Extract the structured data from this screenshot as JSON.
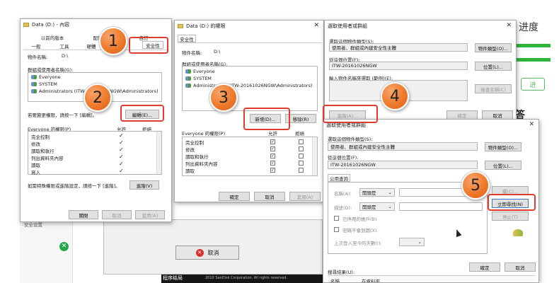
{
  "bg": {
    "title_char": "进度",
    "cursor_hint": "进",
    "question_char": "答",
    "bottom_label": "程序结局",
    "copyright": "2010 SanDisk Corporation. All rights reserved.",
    "cancel_label": "取消",
    "left_text": "安全设置"
  },
  "w1": {
    "title": "Data (D:) - 內容",
    "tabs_top": [
      "以前的版本",
      "配額",
      "自訂"
    ],
    "tabs_bottom": [
      "一般",
      "工具",
      "硬體",
      "共用",
      "安全性"
    ],
    "object_label": "物件名稱:",
    "object_value": "D:\\",
    "group_label": "群組或使用者名稱(G):",
    "users": [
      "Everyone",
      "SYSTEM",
      "Administrators (ITW-20161026NGW\\Administrators)"
    ],
    "change_hint": "若要變更權限，請按一下 [編輯]。",
    "edit_button": "編輯(E)...",
    "perm_label": "Everyone 的權限(P)",
    "allow": "允許",
    "deny": "拒絕",
    "perms": [
      "完全控制",
      "修改",
      "讀取和執行",
      "列出資料夾內容",
      "讀取",
      "寫入"
    ],
    "advanced_hint": "如需特殊權限或進階設定，請按一下 [進階]。",
    "advanced_button": "進階(V)",
    "ok": "關閉",
    "cancel": "取消",
    "apply": "套用(A)"
  },
  "w2": {
    "title": "Data (D:) 的權限",
    "tab": "安全性",
    "object_label": "物件名稱:",
    "object_value": "D:\\",
    "group_label": "群組或使用者名稱(G):",
    "users": [
      "Everyone",
      "SYSTEM",
      "Administrators (ITW-20161026NGW\\Administrators)"
    ],
    "add_button": "新增(D)...",
    "remove_button": "移除(R)",
    "perm_label": "Everyone 的權限(P)",
    "allow": "允許",
    "deny": "拒絕",
    "perms": [
      "完全控制",
      "修改",
      "讀取和執行",
      "列出資料夾內容",
      "讀取"
    ],
    "ok": "確定",
    "cancel": "取消",
    "apply": "套用(A)"
  },
  "w3": {
    "title": "選取使用者或群組",
    "type_label": "選取這個物件類型(S):",
    "type_value": "使用者、群組或內建安全性主體",
    "type_button": "物件類型(O)...",
    "loc_label": "從這個位置(F):",
    "loc_value": "ITW-20161026NGW",
    "loc_button": "位置(L)...",
    "name_label": "輸入物件名稱來選取 (範例)(E):",
    "check_button": "檢查名稱(C)",
    "advanced_button": "進階(A)...",
    "ok": "確定",
    "cancel": "取消"
  },
  "w4": {
    "title": "選取使用者或群組",
    "type_label": "選取這個物件類型(S):",
    "type_value": "使用者、群組或內建安全性主體",
    "type_button": "物件類型(O)...",
    "loc_label": "從這個位置(F):",
    "loc_value": "ITW-20161026NGW",
    "loc_button": "位置(L)...",
    "tab": "公用查詢",
    "name_label": "名稱(A):",
    "desc_label": "描述(D):",
    "starts_with": "開頭是",
    "disabled_label": "已停用的帳戶(B)",
    "noexpire_label": "密碼不會到期(X)",
    "days_label": "上次登入至今的天數(I):",
    "columns_button": "欄(C)...",
    "find_button": "立即尋找(N)",
    "stop_button": "停止(T)",
    "results_label": "搜尋結果(U):",
    "col_name": "名稱",
    "col_folder": "在資料夾",
    "ok": "確定",
    "cancel": "取消"
  },
  "badges": [
    "1",
    "2",
    "3",
    "4",
    "5"
  ],
  "colors": {
    "callout": "#e23b2e",
    "badge": "#ef7a2b",
    "green": "#2fb53b"
  }
}
